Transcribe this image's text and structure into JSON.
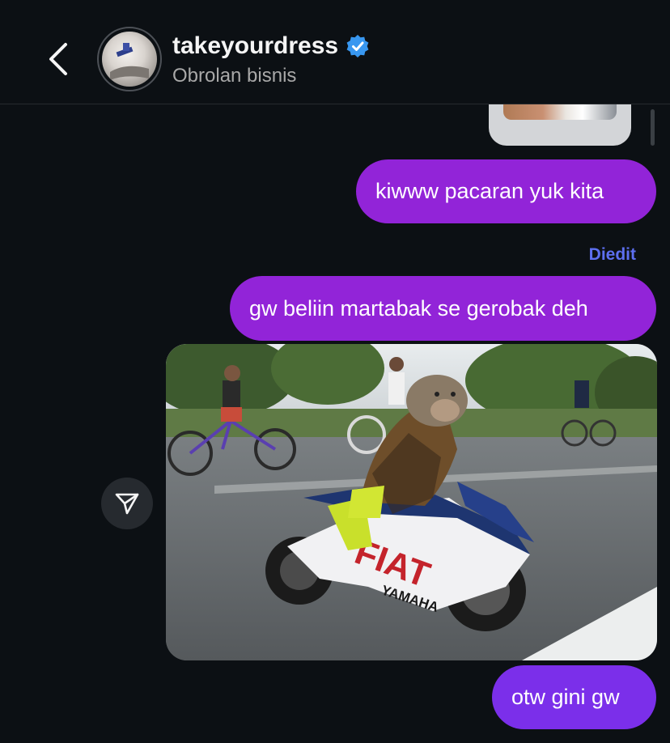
{
  "header": {
    "title": "takeyourdress",
    "subtitle": "Obrolan bisnis",
    "verified": true
  },
  "messages": {
    "m1": "kiwww pacaran yuk kita",
    "edited_label": "Diedit",
    "m2": "gw beliin martabak se gerobak deh",
    "photo_text": {
      "brand": "FIAT",
      "maker": "YAMAHA"
    },
    "m3": "otw gini gw"
  },
  "colors": {
    "bubble_purple": "#9224d8",
    "bubble_last": "#7b2fea",
    "edited_blue": "#5d6ff0",
    "verified_blue": "#3897f0",
    "background": "#0c1014"
  },
  "icons": {
    "back": "chevron-left-icon",
    "verified": "verified-badge-icon",
    "share": "send-icon"
  }
}
